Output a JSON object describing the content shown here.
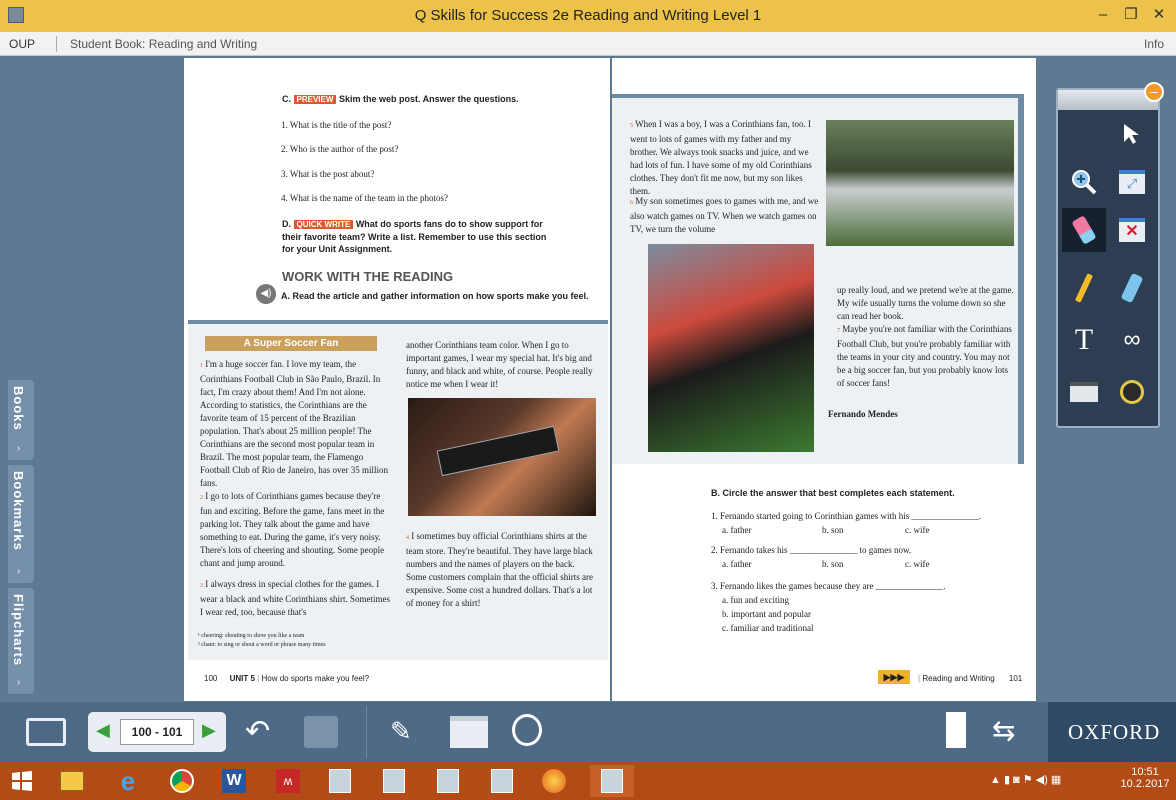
{
  "window": {
    "title": "Q Skills for Success 2e Reading and Writing Level 1",
    "controls": {
      "minimize": "–",
      "restore": "❐",
      "close": "✕"
    }
  },
  "menubar": {
    "publisher": "OUP",
    "book": "Student Book: Reading and Writing",
    "info": "Info"
  },
  "sidebar": {
    "books": "Books",
    "bookmarks": "Bookmarks",
    "flipcharts": "Flipcharts"
  },
  "left_page": {
    "c_label": "C.",
    "c_badge": "PREVIEW",
    "c_instruction": "Skim the web post. Answer the questions.",
    "c_questions": [
      "1. What is the title of the post?",
      "2. Who is the author of the post?",
      "3. What is the post about?",
      "4. What is the name of the team in the photos?"
    ],
    "d_label": "D.",
    "d_badge": "QUICK WRITE",
    "d_instruction": "What do sports fans do to show support for their favorite team? Write a list. Remember to use this section for your Unit Assignment.",
    "work_heading": "WORK WITH THE READING",
    "a_instruction": "A. Read the article and gather information on how sports make you feel.",
    "article_title": "A Super Soccer Fan",
    "col1": {
      "p1": "I'm a huge soccer fan. I love my team, the Corinthians Football Club in São Paulo, Brazil. In fact, I'm crazy about them! And I'm not alone. According to statistics, the Corinthians are the favorite team of 15 percent of the Brazilian population. That's about 25 million people! The Corinthians are the second most popular team in Brazil. The most popular team, the Flamengo Football Club of Rio de Janeiro, has over 35 million fans.",
      "p2": "I go to lots of Corinthians games because they're fun and exciting. Before the game, fans meet in the parking lot. They talk about the game and have something to eat. During the game, it's very noisy. There's lots of cheering and shouting. Some people chant and jump around.",
      "p3": "I always dress in special clothes for the games. I wear a black and white Corinthians shirt. Sometimes I wear red, too, because that's"
    },
    "col2": {
      "p1": "another Corinthians team color. When I go to important games, I wear my special hat. It's big and funny, and black and white, of course. People really notice me when I wear it!",
      "p4": "I sometimes buy official Corinthians shirts at the team store. They're beautiful. They have large black numbers and the names of players on the back. Some customers complain that the official shirts are expensive. Some cost a hundred dollars. That's a lot of money for a shirt!"
    },
    "footnotes": [
      "¹ cheering: shouting to show you like a team",
      "² chant: to sing or shout a word or phrase many times"
    ],
    "footer_page": "100",
    "footer_unit": "UNIT 5",
    "footer_question": "How do sports make you feel?"
  },
  "right_page": {
    "p5": "When I was a boy, I was a Corinthians fan, too. I went to lots of games with my father and my brother. We always took snacks and juice, and we had lots of fun. I have some of my old Corinthians clothes. They don't fit me now, but my son likes them.",
    "p6": "My son sometimes goes to games with me, and we also watch games on TV. When we watch games on TV, we turn the volume",
    "p6_cont": "up really loud, and we pretend we're at the game. My wife usually turns the volume down so she can read her book.",
    "p7": "Maybe you're not familiar with the Corinthians Football Club, but you're probably familiar with the teams in your city and country. You may not be a big soccer fan, but you probably know lots of soccer fans!",
    "author": "Fernando Mendes",
    "b_instruction": "B. Circle the answer that best completes each statement.",
    "b_items": [
      {
        "q": "1. Fernando started going to Corinthian games with his _______________.",
        "a": "a. father",
        "b": "b. son",
        "c": "c. wife"
      },
      {
        "q": "2. Fernando takes his _______________ to games now.",
        "a": "a. father",
        "b": "b. son",
        "c": "c. wife"
      },
      {
        "q": "3. Fernando likes the games because they are _______________.",
        "a": "a. fun and exciting",
        "b": "b. important and popular",
        "c": "c. familiar and traditional"
      }
    ],
    "footer_section": "Reading and Writing",
    "footer_page": "101"
  },
  "toolpanel": {
    "tools": [
      "pointer-icon",
      "zoom-icon",
      "zoom-window-icon",
      "eraser-icon",
      "clear-all-icon",
      "pen-icon",
      "highlighter-icon",
      "text-tool-icon",
      "link-icon",
      "screen-shade-icon",
      "spotlight-icon"
    ],
    "text_tool_glyph": "T"
  },
  "bottombar": {
    "page_range": "100 - 101",
    "brand": "OXFORD"
  },
  "taskbar": {
    "time": "10:51",
    "date": "10.2.2017"
  },
  "colors": {
    "titlebar": "#ecc24a",
    "viewer_bg": "#5f7992",
    "bottombar": "#4e6a86",
    "taskbar": "#b24b16",
    "accent_badge": "#e0582e",
    "highlight": "#f0a0a6"
  }
}
